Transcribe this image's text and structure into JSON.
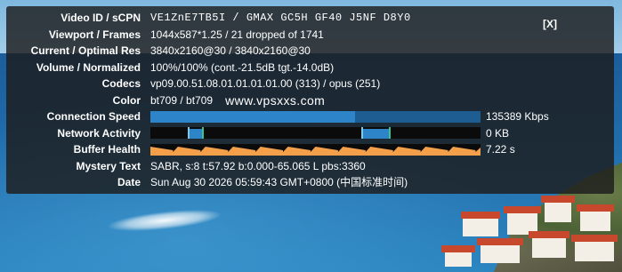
{
  "close_label": "[X]",
  "stats": {
    "video_id": {
      "label": "Video ID / sCPN",
      "value": "VE1ZnE7TB5I / GMAX GC5H GF40 J5NF D8Y0"
    },
    "viewport": {
      "label": "Viewport / Frames",
      "value": "1044x587*1.25 / 21 dropped of 1741"
    },
    "resolution": {
      "label": "Current / Optimal Res",
      "value": "3840x2160@30 / 3840x2160@30"
    },
    "volume": {
      "label": "Volume / Normalized",
      "value": "100%/100% (cont.-21.5dB tgt.-14.0dB)"
    },
    "codecs": {
      "label": "Codecs",
      "value": "vp09.00.51.08.01.01.01.01.00 (313) / opus (251)"
    },
    "color": {
      "label": "Color",
      "value": "bt709 / bt709",
      "watermark": "www.vpsxxs.com"
    },
    "connection_speed": {
      "label": "Connection Speed",
      "value": "135389 Kbps"
    },
    "network_activity": {
      "label": "Network Activity",
      "value": "0 KB"
    },
    "buffer_health": {
      "label": "Buffer Health",
      "value": "7.22 s"
    },
    "mystery_text": {
      "label": "Mystery Text",
      "value": "SABR, s:8 t:57.92 b:0.000-65.065 L pbs:3360"
    },
    "date": {
      "label": "Date",
      "value": "Sun Aug 30 2026 05:59:43 GMT+0800 (中国标准时间)"
    }
  },
  "colors": {
    "connection_bar": "#2e84c9",
    "network_bar": "#2e84c9",
    "buffer_bar": "#f4a04b",
    "panel_bg": "rgba(28,28,28,0.82)"
  }
}
